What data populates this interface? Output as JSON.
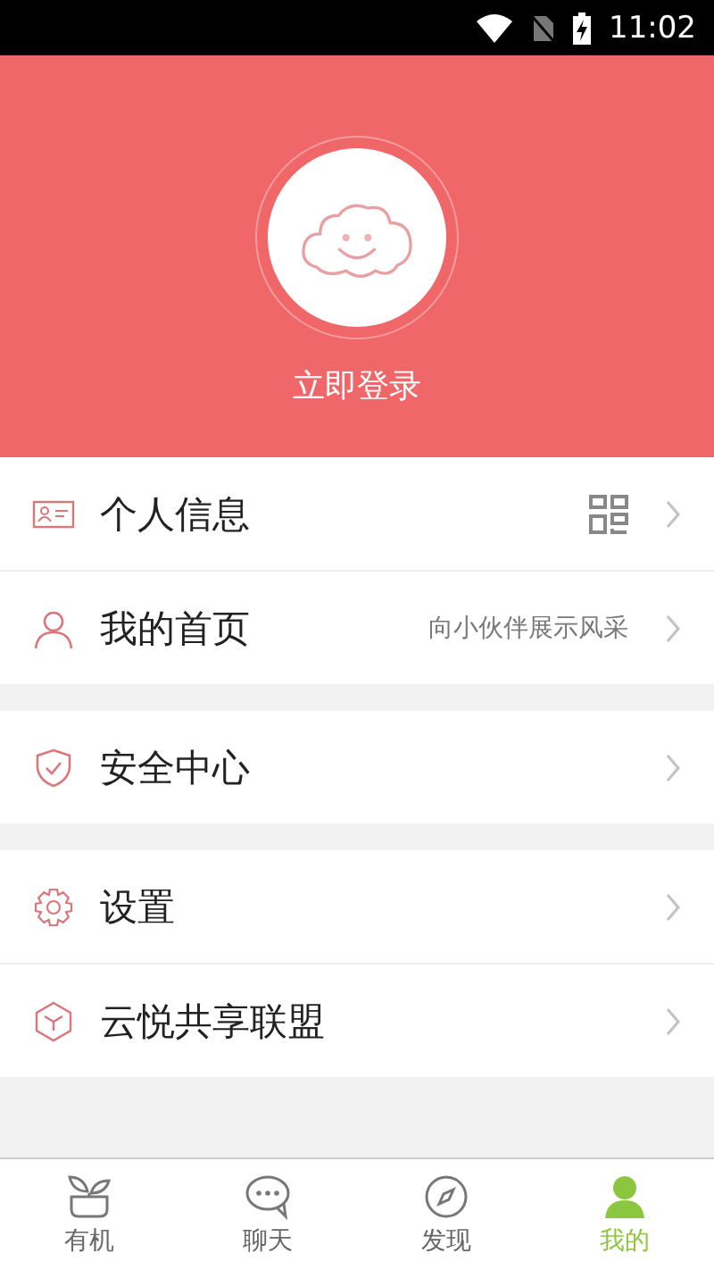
{
  "status_bar": {
    "time": "11:02"
  },
  "header": {
    "login": "立即登录"
  },
  "groups": [
    {
      "rows": [
        {
          "kind": "card",
          "label": "个人信息",
          "qr_code": true
        },
        {
          "kind": "person",
          "label": "我的首页",
          "hint": "向小伙伴展示风采"
        }
      ]
    },
    {
      "rows": [
        {
          "kind": "shield",
          "label": "安全中心"
        }
      ]
    },
    {
      "rows": [
        {
          "kind": "gear",
          "label": "设置"
        },
        {
          "kind": "cube",
          "label": "云悦共享联盟"
        }
      ]
    }
  ],
  "tabs": [
    {
      "kind": "plant",
      "label": "有机",
      "selected": false
    },
    {
      "kind": "chat",
      "label": "聊天",
      "selected": false
    },
    {
      "kind": "compass",
      "label": "发现",
      "selected": false
    },
    {
      "kind": "me",
      "label": "我的",
      "selected": true
    }
  ]
}
